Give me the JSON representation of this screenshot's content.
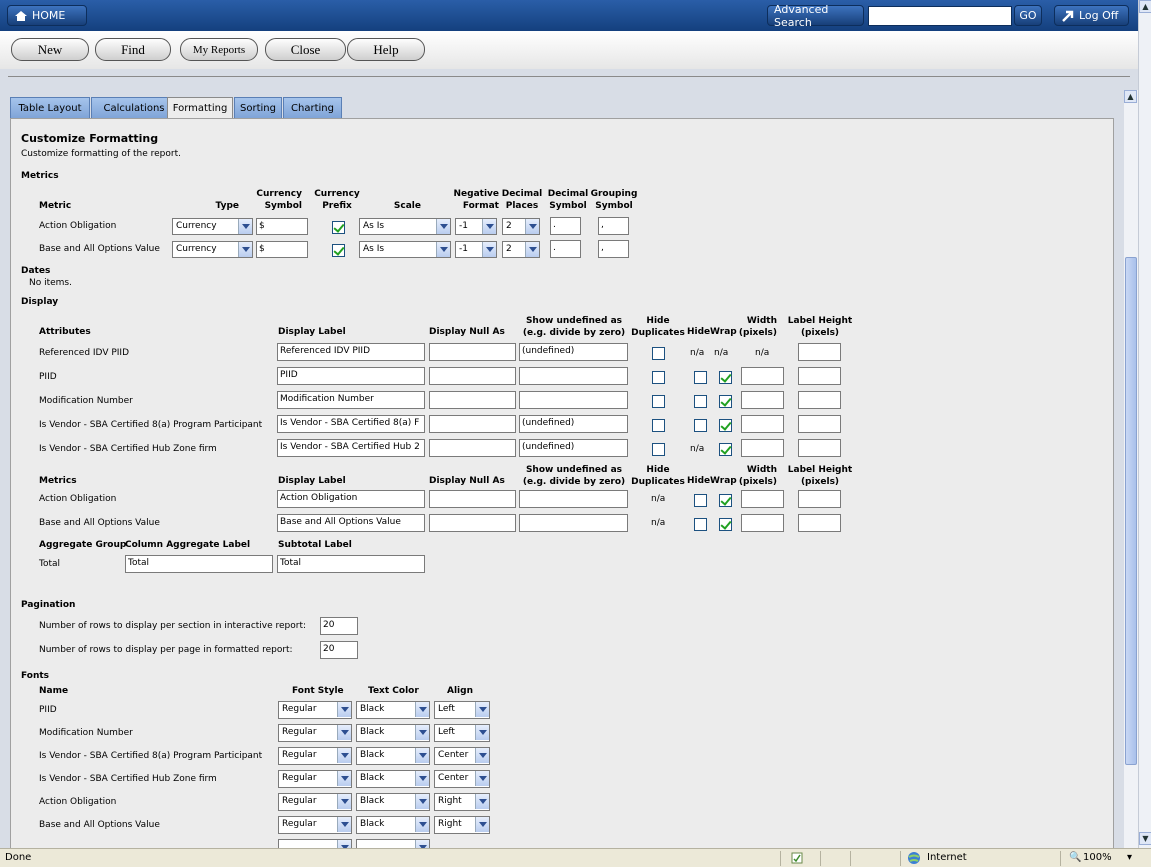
{
  "top_nav": {
    "home_label": "HOME",
    "advanced_search_label": "Advanced Search",
    "search_value": "",
    "go_label": "GO",
    "logoff_label": "Log Off"
  },
  "toolbar": {
    "new": "New",
    "find": "Find",
    "my_reports": "My Reports",
    "close": "Close",
    "help": "Help"
  },
  "tabs": [
    "Table Layout",
    "Calculations",
    "Formatting",
    "Sorting",
    "Charting"
  ],
  "active_tab": "Formatting",
  "page": {
    "title": "Customize Formatting",
    "subtitle": "Customize formatting of the report."
  },
  "metrics": {
    "heading": "Metrics",
    "headers": {
      "metric": "Metric",
      "type": "Type",
      "currency_symbol": "Currency Symbol",
      "currency_prefix": "Currency Prefix",
      "scale": "Scale",
      "negative_format": "Negative Format",
      "decimal_places": "Decimal Places",
      "decimal_symbol": "Decimal Symbol",
      "grouping_symbol": "Grouping Symbol"
    },
    "rows": [
      {
        "metric": "Action Obligation",
        "type": "Currency",
        "currency_symbol": "$",
        "currency_prefix": true,
        "scale": "As Is",
        "negative_format": "-1",
        "decimal_places": "2",
        "decimal_symbol": ".",
        "grouping_symbol": ","
      },
      {
        "metric": "Base and All Options Value",
        "type": "Currency",
        "currency_symbol": "$",
        "currency_prefix": true,
        "scale": "As Is",
        "negative_format": "-1",
        "decimal_places": "2",
        "decimal_symbol": ".",
        "grouping_symbol": ","
      }
    ]
  },
  "dates": {
    "heading": "Dates",
    "empty": "No items."
  },
  "display": {
    "heading": "Display",
    "attr_headers": {
      "name": "Attributes",
      "display_label": "Display Label",
      "display_null": "Display Null As",
      "show_undefined": "Show undefined as (e.g. divide by zero)",
      "hide_duplicates": "Hide Duplicates",
      "hide": "Hide",
      "wrap": "Wrap",
      "width": "Width (pixels)",
      "label_height": "Label Height (pixels)"
    },
    "attributes": [
      {
        "name": "Referenced IDV PIID",
        "label": "Referenced  IDV PIID",
        "null_as": "",
        "undefined": "(undefined)",
        "hide_dup": false,
        "hide": "n/a",
        "wrap": "n/a",
        "width": "n/a",
        "height": ""
      },
      {
        "name": "PIID",
        "label": "PIID",
        "null_as": "",
        "undefined": "",
        "hide_dup": false,
        "hide": false,
        "wrap": true,
        "width": "",
        "height": ""
      },
      {
        "name": "Modification Number",
        "label": "Modification Number",
        "null_as": "",
        "undefined": "",
        "hide_dup": false,
        "hide": false,
        "wrap": true,
        "width": "",
        "height": ""
      },
      {
        "name": "Is Vendor - SBA Certified 8(a) Program Participant",
        "label": "Is Vendor - SBA Certified 8(a) F",
        "null_as": "",
        "undefined": "(undefined)",
        "hide_dup": false,
        "hide": false,
        "wrap": true,
        "width": "",
        "height": ""
      },
      {
        "name": "Is Vendor - SBA Certified Hub Zone firm",
        "label": "Is Vendor - SBA Certified Hub 2",
        "null_as": "",
        "undefined": "(undefined)",
        "hide_dup": false,
        "hide": "n/a",
        "wrap": true,
        "width": "",
        "height": ""
      }
    ],
    "metric_headers": {
      "name": "Metrics",
      "display_label": "Display Label",
      "display_null": "Display Null As",
      "show_undefined": "Show undefined as (e.g. divide by zero)",
      "hide_duplicates": "Hide Duplicates",
      "hide": "Hide",
      "wrap": "Wrap",
      "width": "Width (pixels)",
      "label_height": "Label Height (pixels)"
    },
    "metrics": [
      {
        "name": "Action Obligation",
        "label": "Action Obligation",
        "null_as": "",
        "undefined": "",
        "hide_dup": "n/a",
        "hide": false,
        "wrap": true,
        "width": "",
        "height": ""
      },
      {
        "name": "Base and All Options Value",
        "label": "Base and All Options Value",
        "null_as": "",
        "undefined": "",
        "hide_dup": "n/a",
        "hide": false,
        "wrap": true,
        "width": "",
        "height": ""
      }
    ],
    "aggregate_headers": {
      "group": "Aggregate Group",
      "column_label": "Column Aggregate Label",
      "subtotal": "Subtotal Label"
    },
    "aggregate": {
      "group": "Total",
      "column_label": "Total",
      "subtotal": "Total"
    }
  },
  "pagination": {
    "heading": "Pagination",
    "interactive_label": "Number of rows to display per section in interactive report:",
    "interactive_value": "20",
    "formatted_label": "Number of rows to display per page in formatted report:",
    "formatted_value": "20"
  },
  "fonts": {
    "heading": "Fonts",
    "headers": {
      "name": "Name",
      "style": "Font Style",
      "color": "Text Color",
      "align": "Align"
    },
    "rows": [
      {
        "name": "PIID",
        "style": "Regular",
        "color": "Black",
        "align": "Left"
      },
      {
        "name": "Modification Number",
        "style": "Regular",
        "color": "Black",
        "align": "Left"
      },
      {
        "name": "Is Vendor - SBA Certified 8(a) Program Participant",
        "style": "Regular",
        "color": "Black",
        "align": "Center"
      },
      {
        "name": "Is Vendor - SBA Certified Hub Zone firm",
        "style": "Regular",
        "color": "Black",
        "align": "Center"
      },
      {
        "name": "Action Obligation",
        "style": "Regular",
        "color": "Black",
        "align": "Right"
      },
      {
        "name": "Base and All Options Value",
        "style": "Regular",
        "color": "Black",
        "align": "Right"
      }
    ]
  },
  "statusbar": {
    "status": "Done",
    "zone": "Internet",
    "zoom": "100%"
  },
  "colors": {
    "topbar": "#1f4f94",
    "tab_inactive": "#8fb2e2",
    "panel": "#ececec",
    "check": "#21a121"
  }
}
